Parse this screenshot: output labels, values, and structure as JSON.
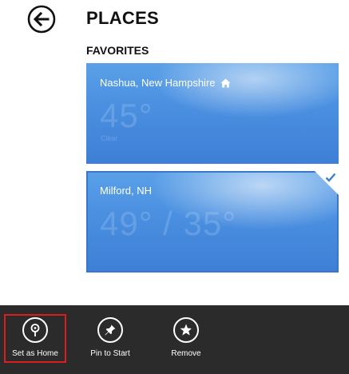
{
  "header": {
    "title": "PLACES"
  },
  "favorites": {
    "section_label": "FAVORITES",
    "tiles": [
      {
        "name": "Nashua, New Hampshire",
        "temperature": "45°",
        "condition": "Clear",
        "is_home": true,
        "selected": false
      },
      {
        "name": "Milford, NH",
        "temperature": "49° / 35°",
        "condition": "",
        "is_home": false,
        "selected": true
      }
    ]
  },
  "app_bar": {
    "commands": [
      {
        "label": "Set as Home",
        "icon": "location-pin-icon",
        "highlighted": true
      },
      {
        "label": "Pin to Start",
        "icon": "pin-icon",
        "highlighted": false
      },
      {
        "label": "Remove",
        "icon": "star-remove-icon",
        "highlighted": false
      }
    ]
  },
  "colors": {
    "tile_blue": "#4a8fe0",
    "app_bar_bg": "#2b2b2b",
    "highlight_frame": "#d81e1e"
  }
}
